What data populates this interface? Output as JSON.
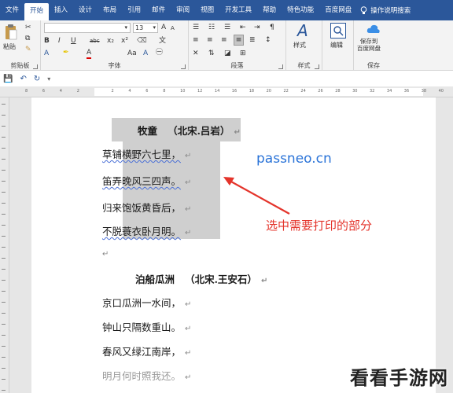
{
  "tabs": [
    "文件",
    "开始",
    "插入",
    "设计",
    "布局",
    "引用",
    "邮件",
    "审阅",
    "视图",
    "开发工具",
    "帮助",
    "特色功能",
    "百度网盘"
  ],
  "active_tab": "开始",
  "tell_me": "操作说明搜索",
  "ribbon": {
    "clipboard": {
      "label": "剪贴板",
      "paste": "粘贴"
    },
    "font": {
      "label": "字体",
      "font_size": "13",
      "bold": "B",
      "italic": "I",
      "underline": "U",
      "strike": "abc",
      "sub": "x₂",
      "sup": "x²",
      "aa_big": "A",
      "aa_small": "A",
      "wen": "文"
    },
    "paragraph": {
      "label": "段落"
    },
    "styles": {
      "label": "样式",
      "button": "样式"
    },
    "edit": {
      "label": "",
      "button": "编辑"
    },
    "save": {
      "label": "保存",
      "button": "保存到\n百度网盘"
    }
  },
  "ruler_ticks": [
    "8",
    "6",
    "4",
    "2",
    "",
    "2",
    "4",
    "6",
    "8",
    "10",
    "12",
    "14",
    "16",
    "18",
    "20",
    "22",
    "24",
    "26",
    "28",
    "30",
    "32",
    "34",
    "36",
    "38",
    "40"
  ],
  "document": {
    "poem1": {
      "title": "牧童",
      "author": "（北宋.吕岩）",
      "lines": [
        "草铺横野六七里，",
        "笛弄晚风三四声。",
        "归来饱饭黄昏后，",
        "不脱蓑衣卧月明。"
      ]
    },
    "poem2": {
      "title": "泊船瓜洲",
      "author": "（北宋.王安石）",
      "lines": [
        "京口瓜洲一水间，",
        "钟山只隔数重山。",
        "春风又绿江南岸，",
        "明月何时照我还。"
      ]
    },
    "return_mark": "↵"
  },
  "watermark": "passneo.cn",
  "annotation": "选中需要打印的部分",
  "brand": "看看手游网",
  "colors": {
    "ribbon_blue": "#2b579a",
    "highlight": "#cfcfcf",
    "annotation": "#e4342b",
    "watermark": "#2b74d8"
  }
}
